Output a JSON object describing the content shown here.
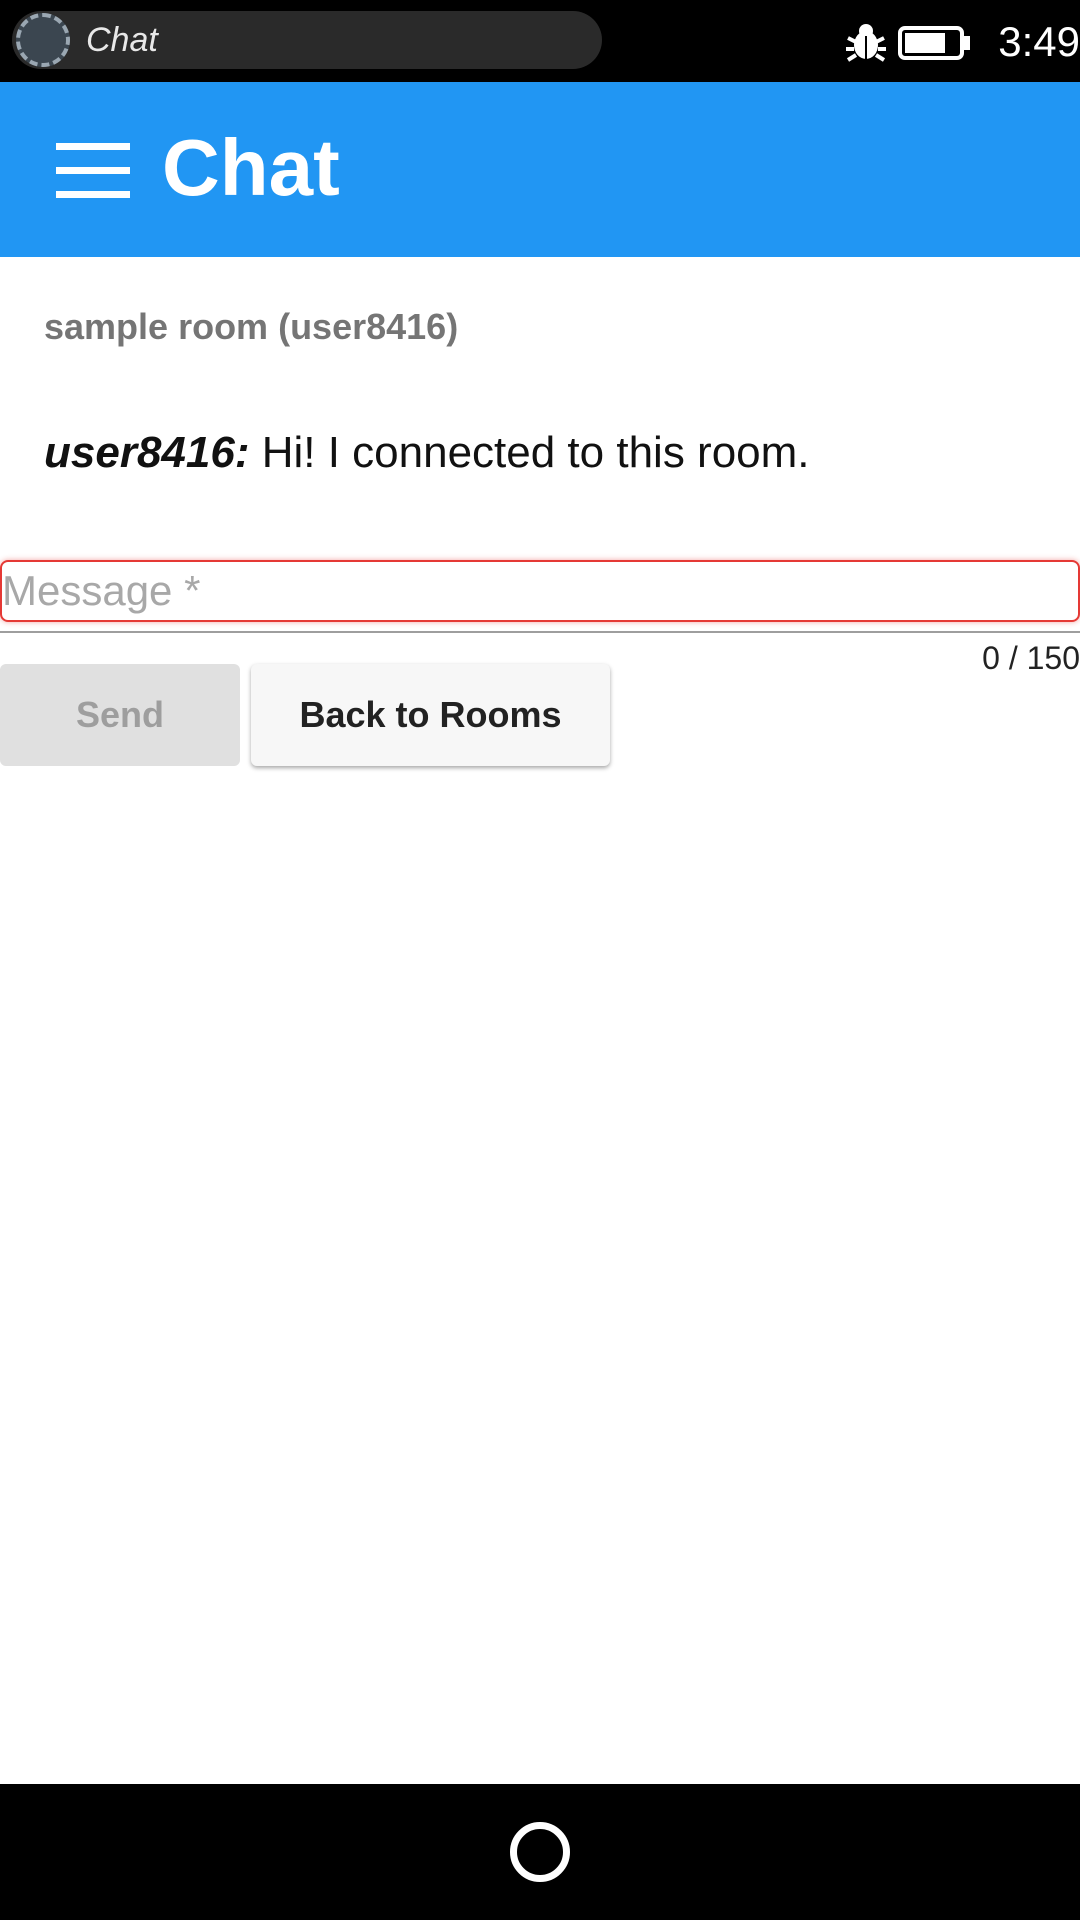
{
  "status_bar": {
    "app_pill_title": "Chat",
    "time": "3:49",
    "icons": [
      "app-loading-icon",
      "bug-icon",
      "battery-icon"
    ]
  },
  "app_bar": {
    "menu_icon": "hamburger-menu-icon",
    "title": "Chat",
    "color": "#2196f3"
  },
  "room": {
    "name_prefix": "sample room (",
    "user": "user8416",
    "name_suffix": ")"
  },
  "messages": [
    {
      "author": "user8416:",
      "text": " Hi! I connected to this room."
    }
  ],
  "composer": {
    "placeholder": "Message *",
    "value": "",
    "counter": "0 / 150",
    "error_color": "#e53935"
  },
  "buttons": {
    "send_label": "Send",
    "back_label": "Back to Rooms"
  },
  "nav_bar": {
    "home_icon": "home-circle-icon"
  }
}
